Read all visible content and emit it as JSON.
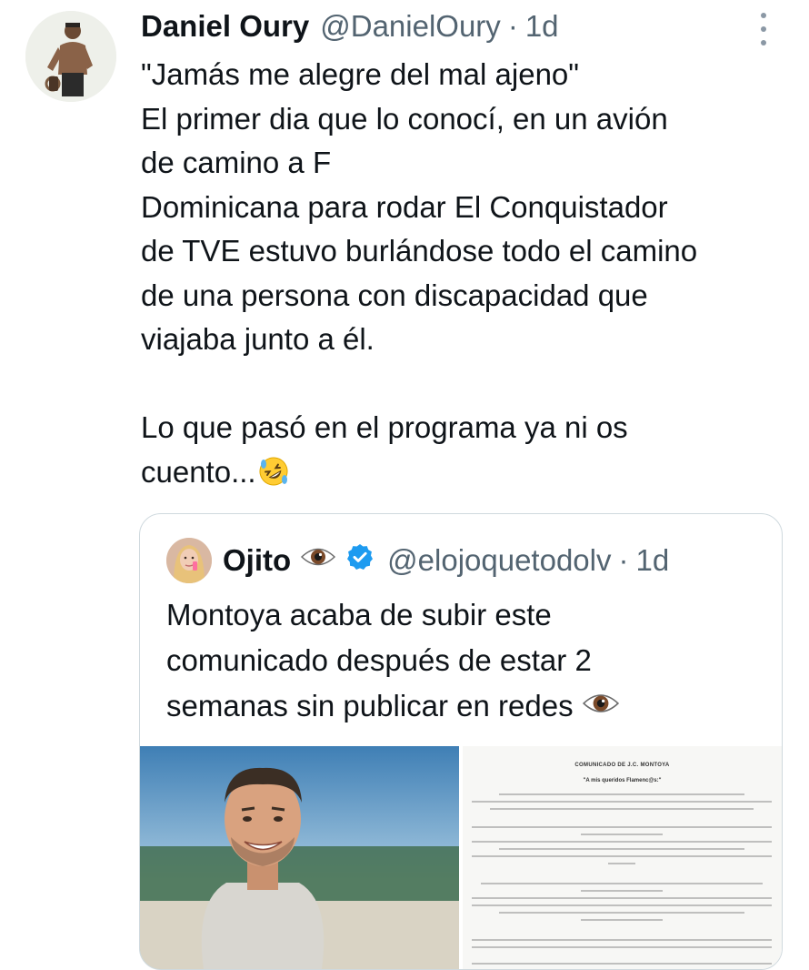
{
  "tweet": {
    "author_name": "Daniel Oury",
    "author_handle": "@DanielOury",
    "separator": "·",
    "time": "1d",
    "lines": [
      "\"Jamás me alegre del mal ajeno\"",
      "El primer dia que lo conocí, en un avión",
      "de camino a F",
      "Dominicana para rodar El Conquistador",
      "de TVE estuvo burlándose todo el camino",
      "de una persona con discapacidad que",
      "viajaba junto a él.",
      "",
      "Lo que pasó en el programa ya ni os",
      "cuento..."
    ],
    "emoji": "rolling-on-floor-laughing-emoji",
    "more_icon": "more-vertical-icon"
  },
  "quoted_tweet": {
    "author_name": "Ojito",
    "name_emoji": "eye-emoji",
    "verified_icon": "verified-badge-icon",
    "author_handle": "@elojoquetodolv",
    "separator": "·",
    "time": "1d",
    "lines": [
      "Montoya acaba de subir este",
      "comunicado después de estar 2",
      "semanas sin publicar en redes"
    ],
    "end_emoji": "eye-emoji",
    "media": {
      "photo": "smiling-man-beach-photo",
      "document": {
        "title": "COMUNICADO DE J.C. MONTOYA",
        "greeting": "\"A mis queridos Flamenc@s:\""
      }
    }
  },
  "colors": {
    "text": "#0f1419",
    "secondary": "#536471",
    "border": "#cfd9de",
    "verified": "#1d9bf0"
  }
}
